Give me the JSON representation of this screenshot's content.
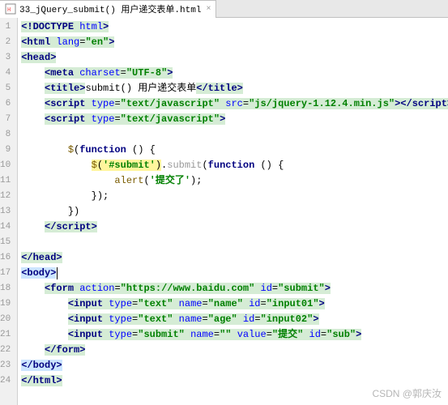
{
  "tab": {
    "filename": "33_jQuery_submit() 用户递交表单.html"
  },
  "code": {
    "l1": {
      "pre": "<!DOCTYPE ",
      "attr": "html",
      "post": ">"
    },
    "l2": {
      "open": "<html ",
      "attr": "lang",
      "eq": "=",
      "val": "\"en\"",
      "close": ">"
    },
    "l3": {
      "tag": "<head>"
    },
    "l4": {
      "open": "<meta ",
      "attr": "charset",
      "eq": "=",
      "val": "\"UTF-8\"",
      "close": ">"
    },
    "l5": {
      "open": "<title>",
      "text": "submit() 用户递交表单",
      "close": "</title>"
    },
    "l6": {
      "open": "<script ",
      "a1": "type",
      "v1": "\"text/javascript\"",
      "a2": "src",
      "v2": "\"js/jquery-1.12.4.min.js\"",
      "mid": ">",
      "close": "</script>"
    },
    "l7": {
      "open": "<script ",
      "a1": "type",
      "v1": "\"text/javascript\"",
      "close": ">"
    },
    "l9": {
      "dollar": "$",
      "open": "(",
      "fn": "function ",
      "paren": "() {"
    },
    "l10": {
      "dollar": "$",
      "open": "(",
      "sel": "'#submit'",
      "close1": ")",
      "dot": ".",
      "method": "submit",
      "open2": "(",
      "fn": "function ",
      "paren": "() {"
    },
    "l11": {
      "fn": "alert",
      "open": "(",
      "arg": "'提交了'",
      "close": ");"
    },
    "l12": {
      "text": "});"
    },
    "l13": {
      "text": "})"
    },
    "l14": {
      "tag": "</script>"
    },
    "l16": {
      "tag": "</head>"
    },
    "l17": {
      "tag": "<body>"
    },
    "l18": {
      "open": "<form ",
      "a1": "action",
      "v1": "\"https://www.baidu.com\"",
      "a2": "id",
      "v2": "\"submit\"",
      "close": ">"
    },
    "l19": {
      "open": "<input ",
      "a1": "type",
      "v1": "\"text\"",
      "a2": "name",
      "v2": "\"name\"",
      "a3": "id",
      "v3": "\"input01\"",
      "close": ">"
    },
    "l20": {
      "open": "<input ",
      "a1": "type",
      "v1": "\"text\"",
      "a2": "name",
      "v2": "\"age\"",
      "a3": "id",
      "v3": "\"input02\"",
      "close": ">"
    },
    "l21": {
      "open": "<input ",
      "a1": "type",
      "v1": "\"submit\"",
      "a2": "name",
      "v2": "\"\"",
      "a3": "value",
      "v3": "\"提交\"",
      "a4": "id",
      "v4": "\"sub\"",
      "close": ">"
    },
    "l22": {
      "tag": "</form>"
    },
    "l23": {
      "tag": "</body>"
    },
    "l24": {
      "tag": "</html>"
    }
  },
  "watermark": "CSDN @郭庆汝"
}
